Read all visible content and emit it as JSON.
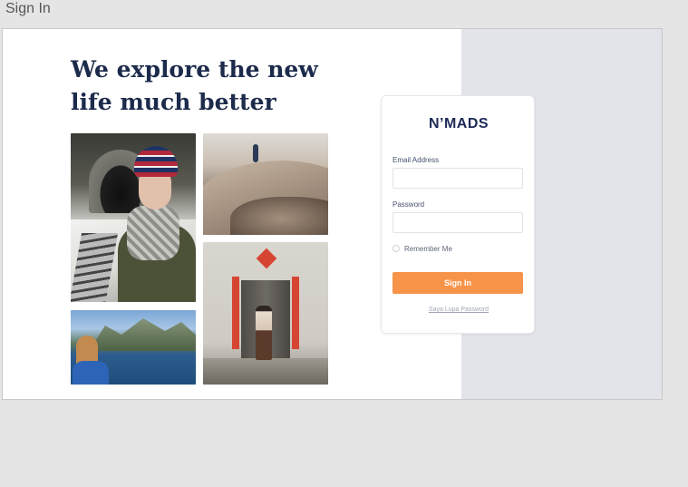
{
  "page": {
    "label": "Sign In"
  },
  "hero": {
    "headline_line1": "We explore the new",
    "headline_line2": "life much better"
  },
  "gallery": {
    "photos": [
      {
        "name": "woman-beanie-tunnel-photo"
      },
      {
        "name": "desert-dunes-photo"
      },
      {
        "name": "chinese-door-photo"
      },
      {
        "name": "fjord-view-photo"
      }
    ]
  },
  "login": {
    "logo_text": "N’MADS",
    "email_label": "Email Address",
    "email_value": "",
    "email_placeholder": "",
    "password_label": "Password",
    "password_value": "",
    "password_placeholder": "",
    "remember_label": "Remember Me",
    "remember_checked": false,
    "signin_label": "Sign In",
    "forgot_label": "Saya Lupa Password"
  },
  "colors": {
    "accent": "#f7944a",
    "headline": "#1c2b4b",
    "logo": "#1d2a57",
    "right_panel": "#e2e4ea"
  }
}
